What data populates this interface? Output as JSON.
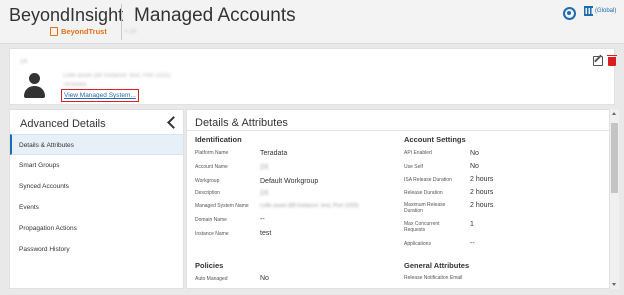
{
  "header": {
    "brand_title": "BeyondInsight",
    "brand_logo_text": "BeyondTrust",
    "page_title": "Managed Accounts",
    "breadcrumb": "> 2X",
    "global_label": "(Global)",
    "user_icon": "user-circle-icon",
    "global_icon": "bank-icon",
    "accent_color": "#1e6bb0"
  },
  "account": {
    "name": "2X",
    "description": "Lolle asset (88 Instance: test, Port 1025)",
    "subtext": "Teradata",
    "view_system_link": "View Managed System..."
  },
  "left_panel": {
    "title": "Advanced Details",
    "items": [
      {
        "label": "Details & Attributes",
        "active": true
      },
      {
        "label": "Smart Groups"
      },
      {
        "label": "Synced Accounts"
      },
      {
        "label": "Events"
      },
      {
        "label": "Propagation Actions"
      },
      {
        "label": "Password History"
      }
    ]
  },
  "main": {
    "title": "Details & Attributes",
    "identification": {
      "title": "Identification",
      "rows": [
        {
          "label": "Platform Name",
          "value": "Teradata"
        },
        {
          "label": "Account Name",
          "value": "2X"
        },
        {
          "label": "Workgroup",
          "value": "Default Workgroup"
        },
        {
          "label": "Description",
          "value": "2X"
        },
        {
          "label": "Managed System Name",
          "value": "Lolle asset (88 Instance: test, Port 1025)"
        },
        {
          "label": "Domain Name",
          "value": "--"
        },
        {
          "label": "Instance Name",
          "value": "test"
        }
      ]
    },
    "account_settings": {
      "title": "Account Settings",
      "rows": [
        {
          "label": "API Enabled",
          "value": "No"
        },
        {
          "label": "Use Self",
          "value": "No"
        },
        {
          "label": "ISA Release Duration",
          "value": "2 hours"
        },
        {
          "label": "Release Duration",
          "value": "2 hours"
        },
        {
          "label": "Maximum Release Duration",
          "value": "2 hours"
        },
        {
          "label": "Max Concurrent Requests",
          "value": "1"
        },
        {
          "label": "Applications",
          "value": "--"
        }
      ]
    },
    "policies": {
      "title": "Policies",
      "rows": [
        {
          "label": "Auto Managed",
          "value": "No"
        }
      ]
    },
    "general_attributes": {
      "title": "General Attributes",
      "rows": [
        {
          "label": "Release Notification Email",
          "value": ""
        }
      ]
    }
  }
}
